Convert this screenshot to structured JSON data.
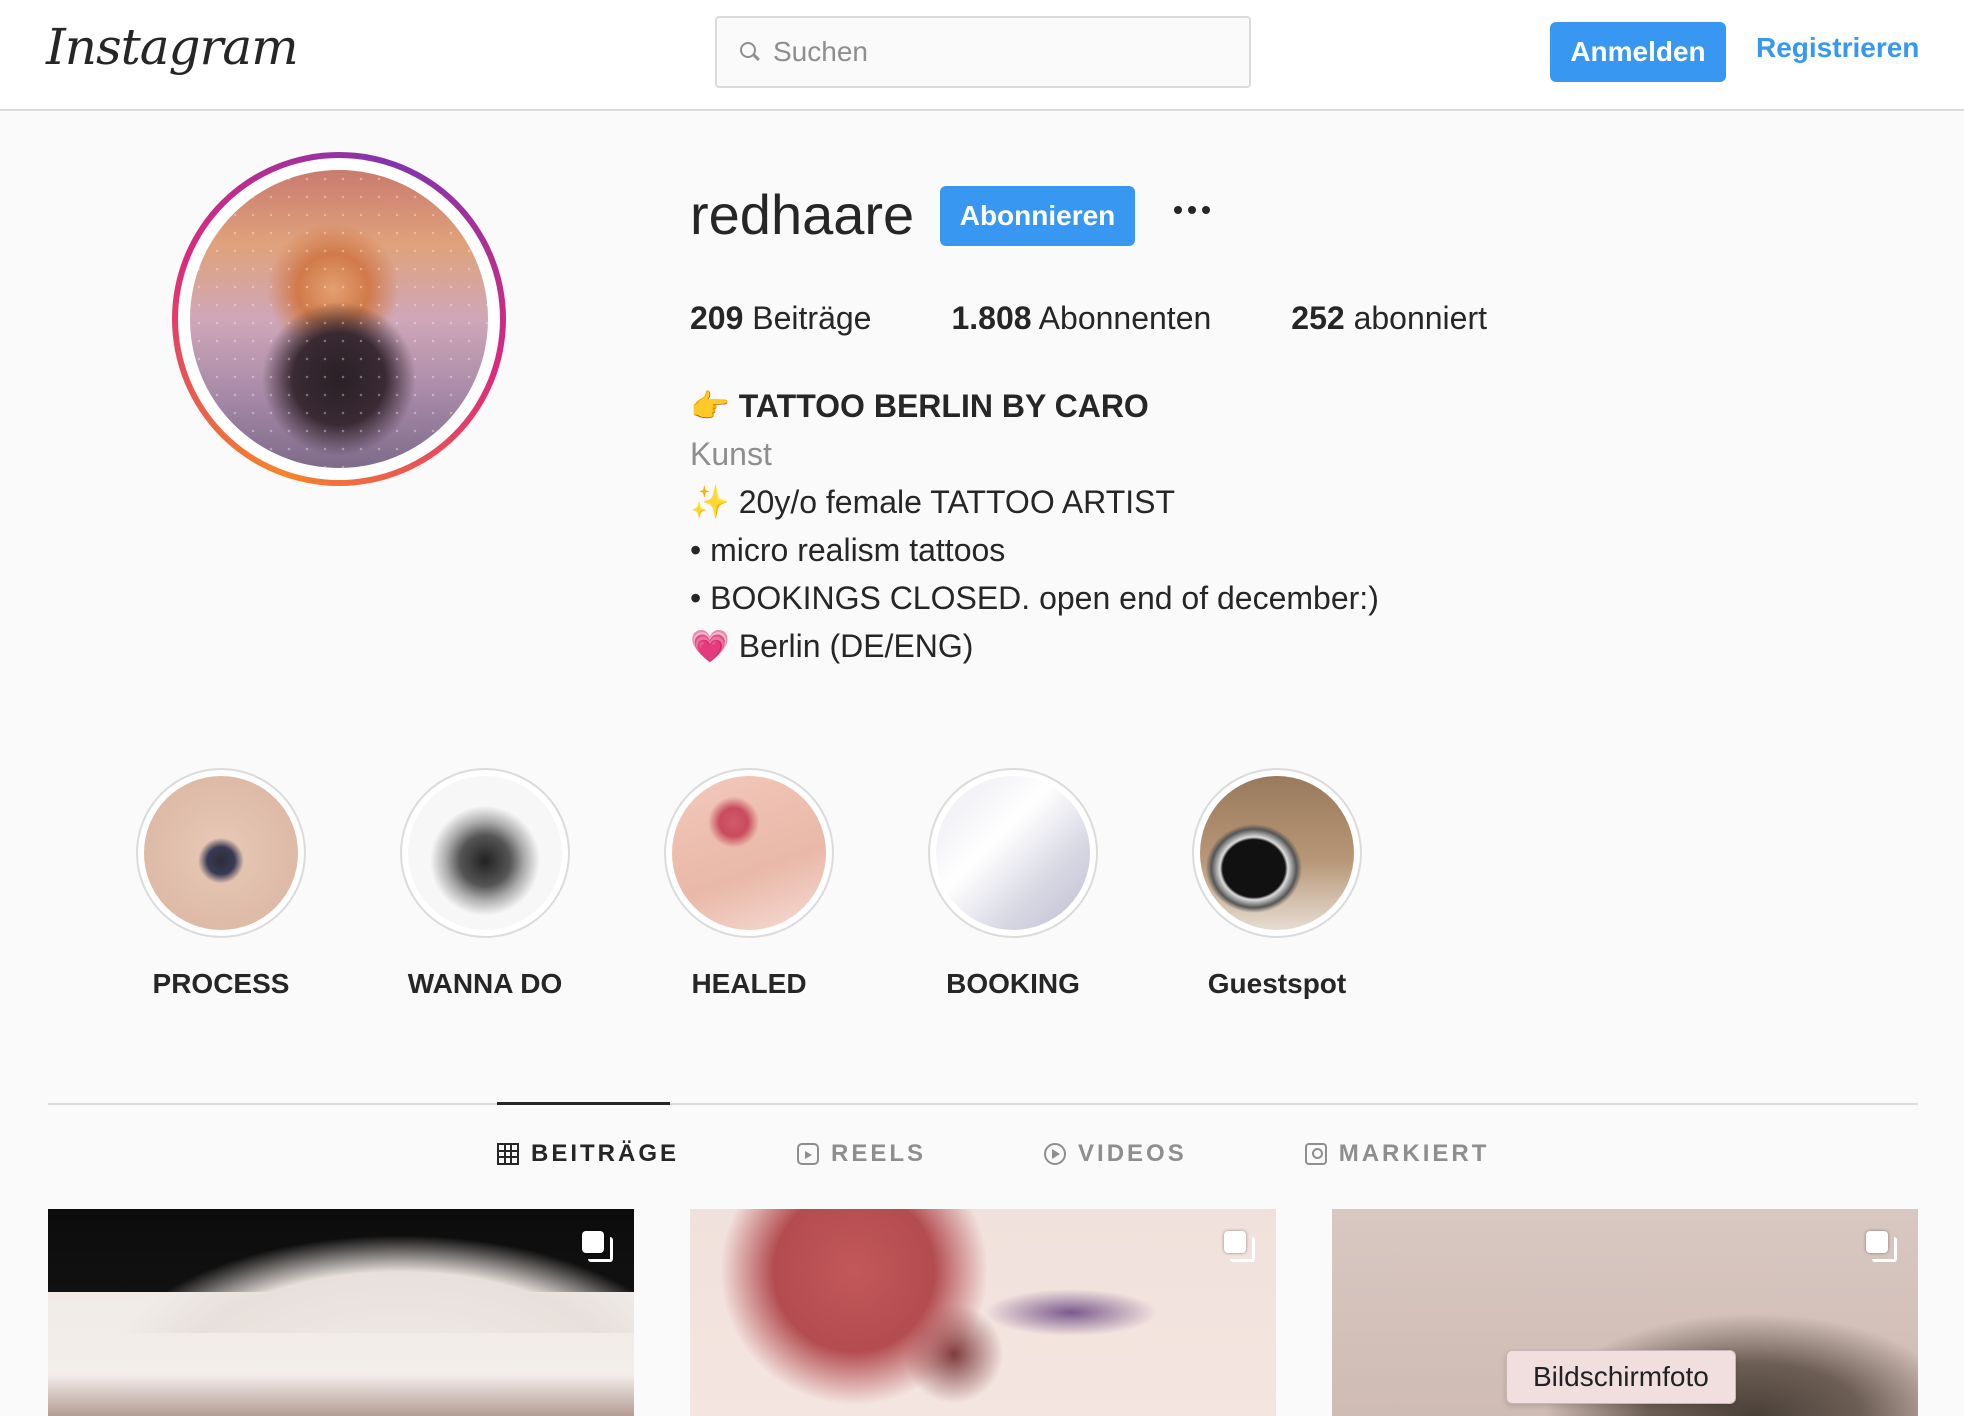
{
  "header": {
    "logo": "Instagram",
    "search_placeholder": "Suchen",
    "login_label": "Anmelden",
    "register_label": "Registrieren"
  },
  "profile": {
    "username": "redhaare",
    "follow_label": "Abonnieren",
    "stats": [
      {
        "count": "209",
        "label": "Beiträge"
      },
      {
        "count": "1.808",
        "label": "Abonnenten"
      },
      {
        "count": "252",
        "label": "abonniert"
      }
    ],
    "bio": {
      "name": "👉 TATTOO BERLIN BY CARO",
      "category": "Kunst",
      "lines": [
        "✨ 20y/o female TATTOO ARTIST",
        "• micro realism tattoos",
        "• BOOKINGS CLOSED. open end of december:)",
        "💗 Berlin (DE/ENG)"
      ]
    }
  },
  "highlights": [
    {
      "label": "PROCESS"
    },
    {
      "label": "WANNA DO"
    },
    {
      "label": "HEALED"
    },
    {
      "label": "BOOKING"
    },
    {
      "label": "Guestspot"
    }
  ],
  "tabs": [
    {
      "label": "BEITRÄGE",
      "icon": "grid-icon",
      "active": true
    },
    {
      "label": "REELS",
      "icon": "reels-icon",
      "active": false
    },
    {
      "label": "VIDEOS",
      "icon": "video-icon",
      "active": false
    },
    {
      "label": "MARKIERT",
      "icon": "tagged-icon",
      "active": false
    }
  ],
  "tooltip": "Bildschirmfoto",
  "colors": {
    "accent": "#3897f0",
    "text": "#262626",
    "muted": "#8e8e8e",
    "border": "#dbdbdb",
    "background": "#fafafa"
  }
}
